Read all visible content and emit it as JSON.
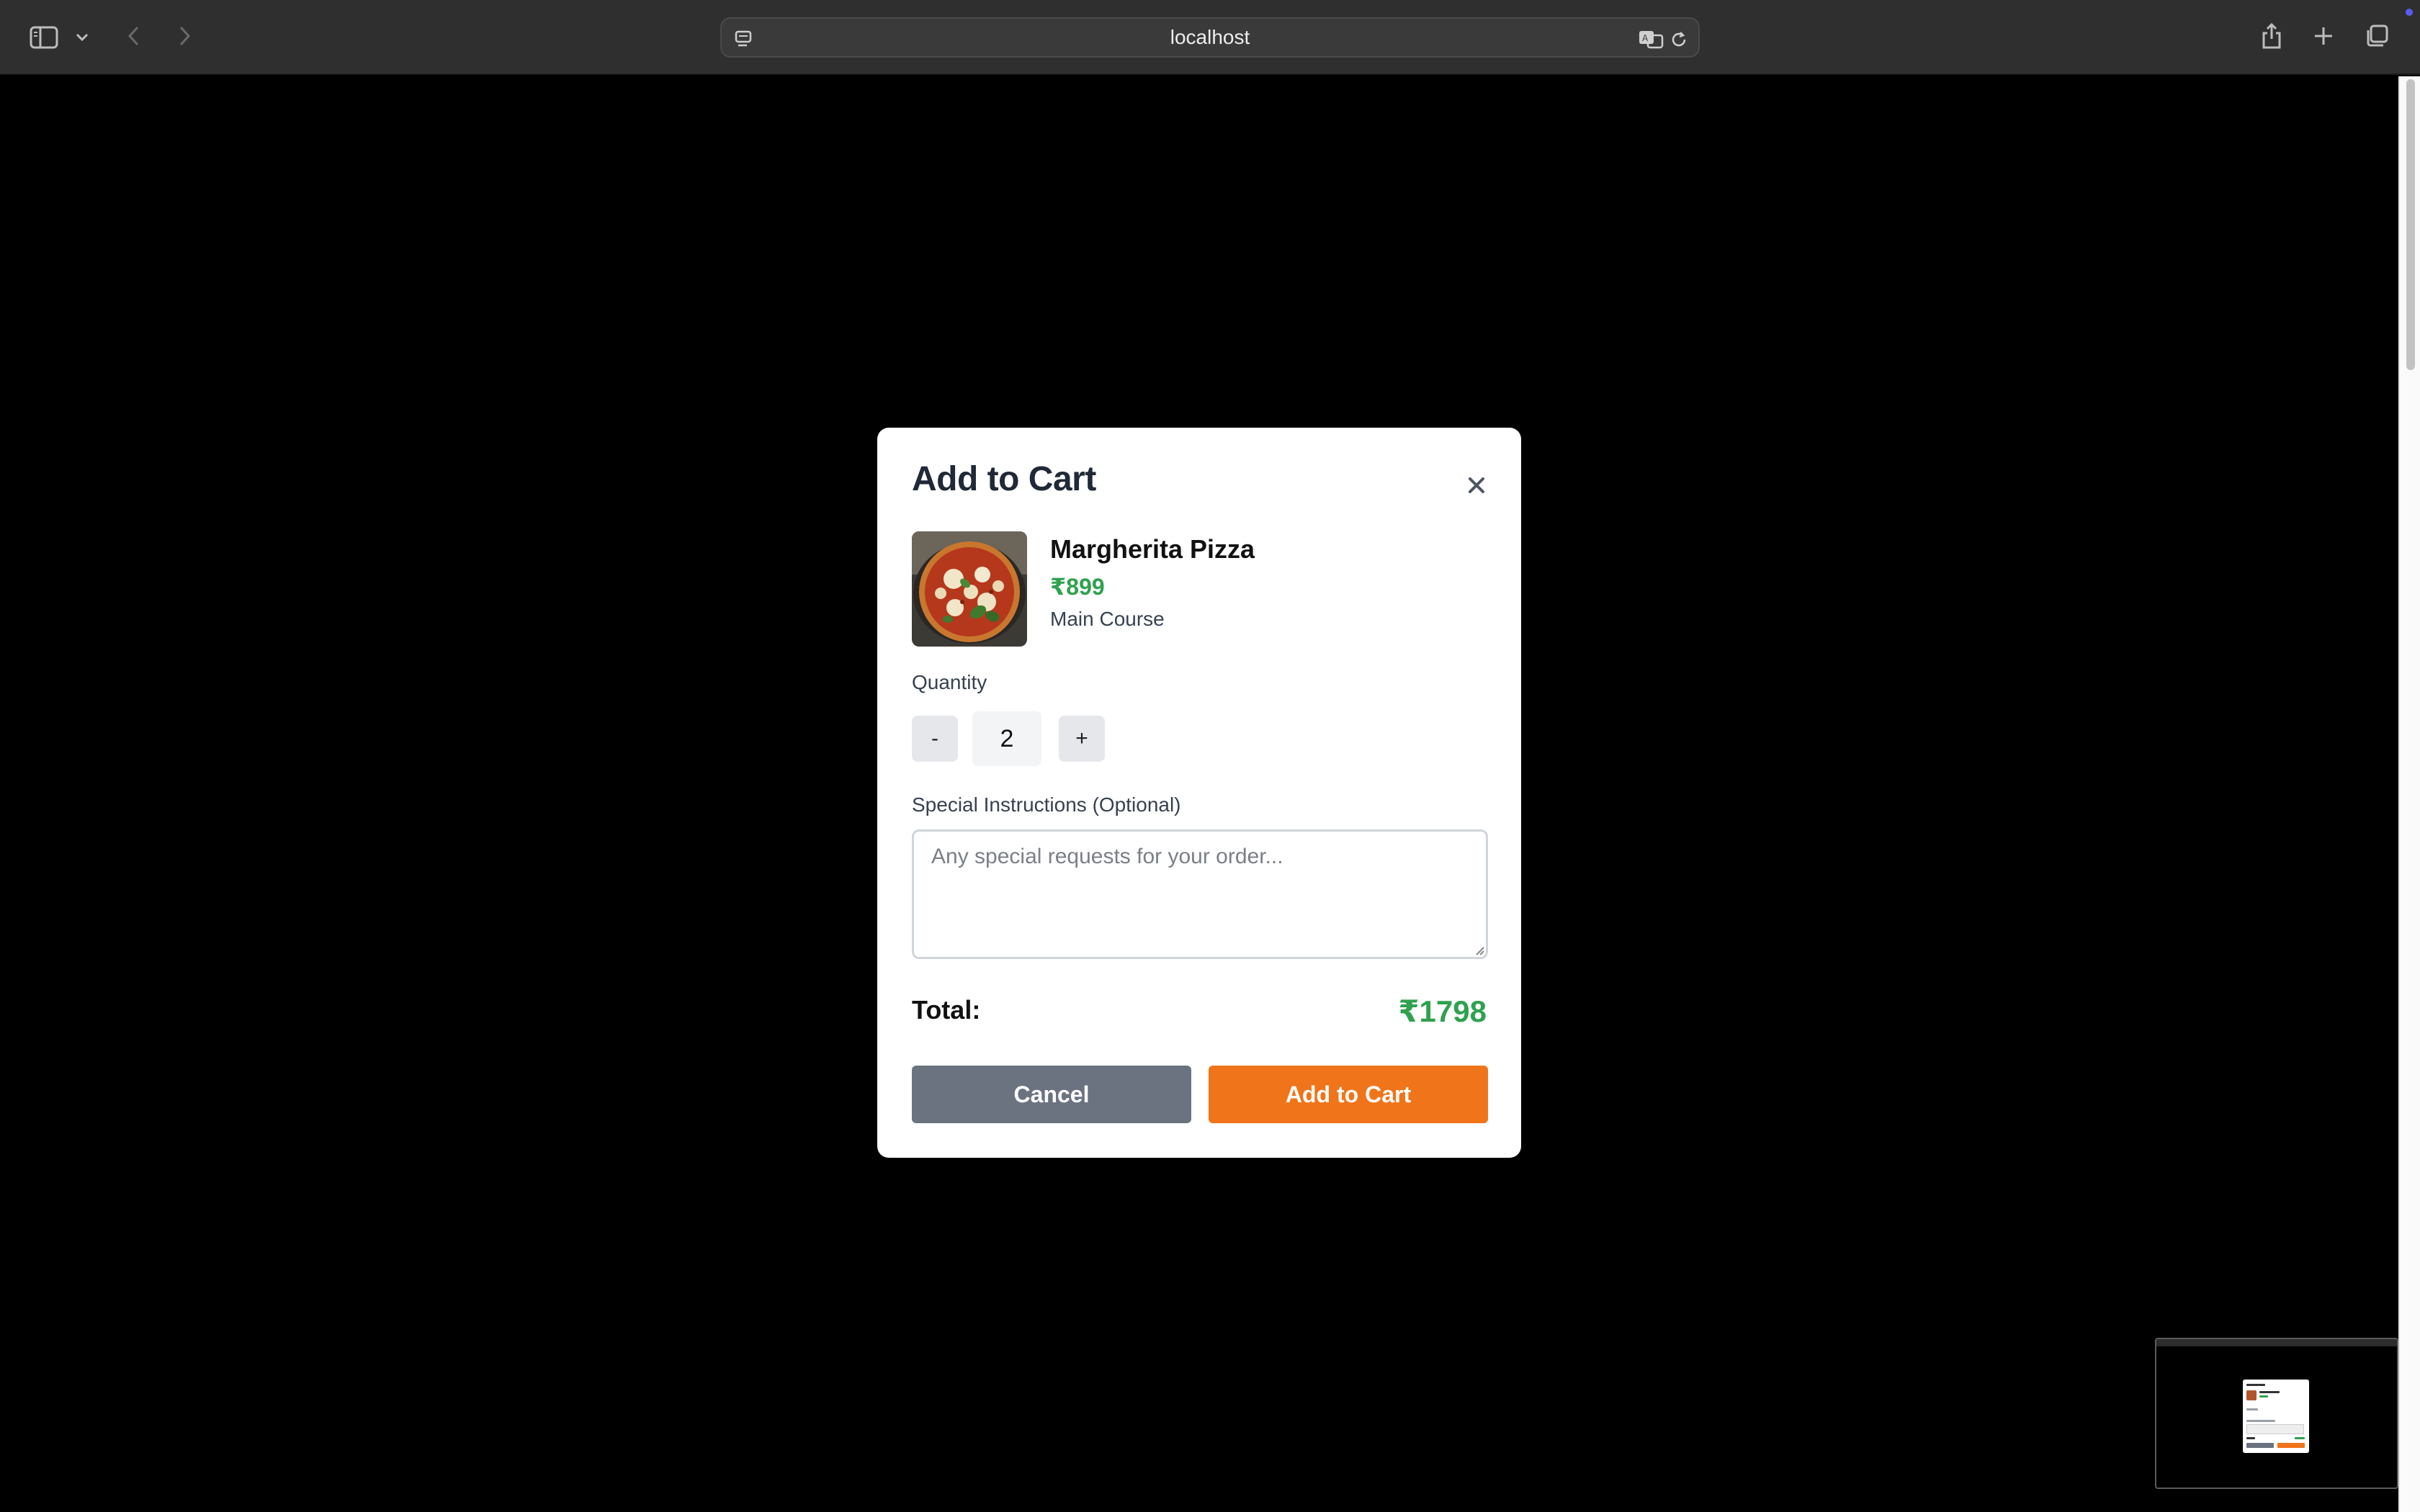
{
  "browser": {
    "url": "localhost"
  },
  "modal": {
    "title": "Add to Cart",
    "product": {
      "name": "Margherita Pizza",
      "price": "₹899",
      "category": "Main Course"
    },
    "quantity": {
      "label": "Quantity",
      "decrement_label": "-",
      "value": "2",
      "increment_label": "+"
    },
    "instructions": {
      "label": "Special Instructions (Optional)",
      "placeholder": "Any special requests for your order...",
      "value": ""
    },
    "total": {
      "label": "Total:",
      "value": "₹1798"
    },
    "buttons": {
      "cancel_label": "Cancel",
      "add_label": "Add to Cart"
    }
  },
  "colors": {
    "accent": "#f07419",
    "price": "#2fa14f",
    "cancel": "#6b7280",
    "title": "#1f2937"
  }
}
